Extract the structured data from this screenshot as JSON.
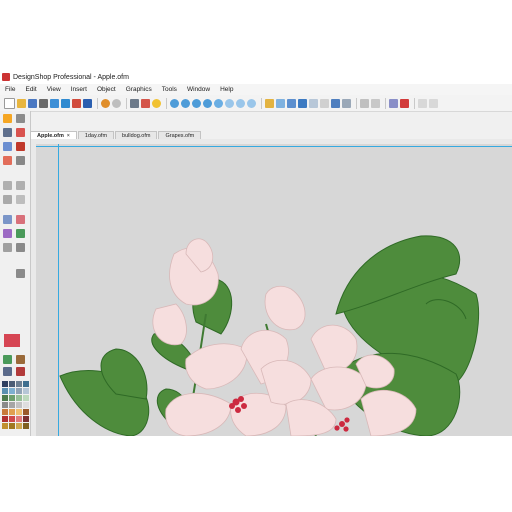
{
  "window": {
    "title": "DesignShop Professional - Apple.ofm"
  },
  "menu": [
    "File",
    "Edit",
    "View",
    "Insert",
    "Object",
    "Graphics",
    "Tools",
    "Window",
    "Help"
  ],
  "tabs": [
    {
      "label": "Apple.ofm",
      "active": true,
      "close": "×"
    },
    {
      "label": "1day.ofm",
      "active": false
    },
    {
      "label": "bulldog.ofm",
      "active": false
    },
    {
      "label": "Grapes.ofm",
      "active": false
    }
  ],
  "colors": {
    "guide": "#36a9e0",
    "canvas": "#d7d7d7",
    "leaf": "#4e8c3c",
    "petal": "#f6dede",
    "stamen": "#cc2a40",
    "current_color": "#d64553"
  },
  "icons": {
    "toolbar": [
      "new-icon",
      "open-icon",
      "save-icon",
      "print-icon",
      "undo-icon",
      "redo-icon",
      "help-icon",
      "zoom-in-icon",
      "zoom-out-icon",
      "zoom-fit-icon",
      "zoom-icon",
      "zoom-icon",
      "zoom-icon",
      "grid-icon",
      "measure-icon",
      "hoop-icon",
      "stitch-icon",
      "threads-icon",
      "layout-icon",
      "settings-icon",
      "tools-icon"
    ],
    "toolbox": [
      "select-icon",
      "pen-icon",
      "brush-icon",
      "eraser-icon",
      "shape-icon",
      "text-icon",
      "fill-icon",
      "node-icon",
      "warp-icon",
      "star-icon",
      "gear-icon",
      "palette-icon"
    ]
  }
}
